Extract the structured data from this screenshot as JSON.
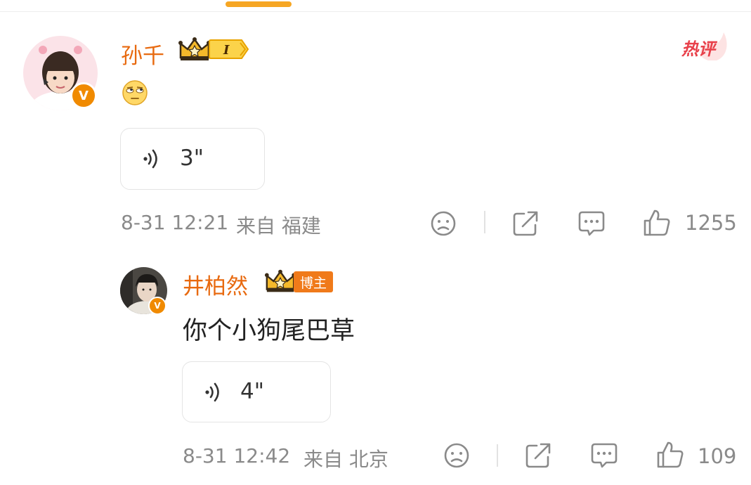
{
  "comment": {
    "username": "孙千",
    "level_badge": "I",
    "hot_tag": "热评",
    "emoji_icon": "rolling-eyes-emoji",
    "voice_duration": "3\"",
    "timestamp": "8-31 12:21",
    "location": "来自 福建",
    "like_count": "1255",
    "verified_badge": "V"
  },
  "reply": {
    "username": "井柏然",
    "role_badge": "博主",
    "text": "你个小狗尾巴草",
    "voice_duration": "4\"",
    "timestamp": "8-31 12:42",
    "location": "来自 北京",
    "like_count": "109",
    "verified_badge": "V"
  },
  "colors": {
    "accent_orange": "#e86a10",
    "verified_orange": "#f08a00",
    "hot_red": "#e8404a",
    "meta_gray": "#8a8a8a",
    "tab_indicator": "#f6a623"
  }
}
